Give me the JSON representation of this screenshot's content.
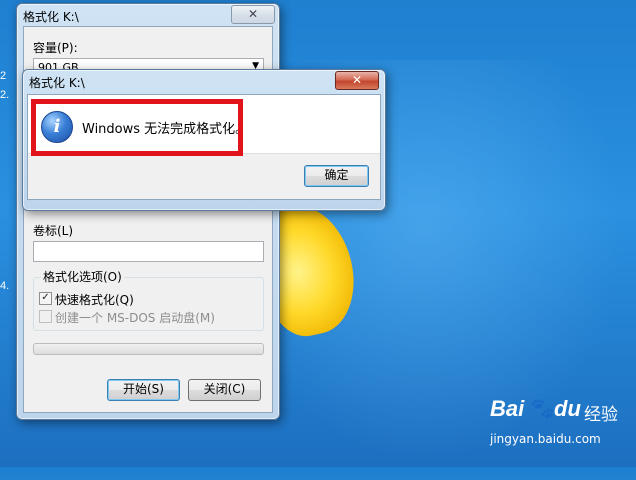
{
  "desktop": {
    "icon_labels": [
      "2",
      "2.",
      "4."
    ],
    "watermark": {
      "brand": "Bai",
      "paw": "du",
      "section": "经验",
      "url": "jingyan.baidu.com"
    }
  },
  "format_window": {
    "title": "格式化 K:\\",
    "close_glyph": "✕",
    "capacity_label": "容量(P):",
    "capacity_value": "901 GB",
    "volume_label": "卷标(L)",
    "volume_value": "",
    "options_group": "格式化选项(O)",
    "quick_format": {
      "label": "快速格式化(Q)",
      "checked": true,
      "mark": "✓"
    },
    "msdos_disk": {
      "label": "创建一个 MS-DOS 启动盘(M)",
      "checked": false
    },
    "progress": 0,
    "start_label": "开始(S)",
    "close_label": "关闭(C)"
  },
  "message_box": {
    "title": "格式化 K:\\",
    "close_glyph": "✕",
    "icon": "info-icon",
    "icon_glyph": "i",
    "message": "Windows 无法完成格式化。",
    "ok_label": "确定"
  },
  "colors": {
    "highlight": "#e0141a",
    "desktop": "#2a90e0"
  }
}
